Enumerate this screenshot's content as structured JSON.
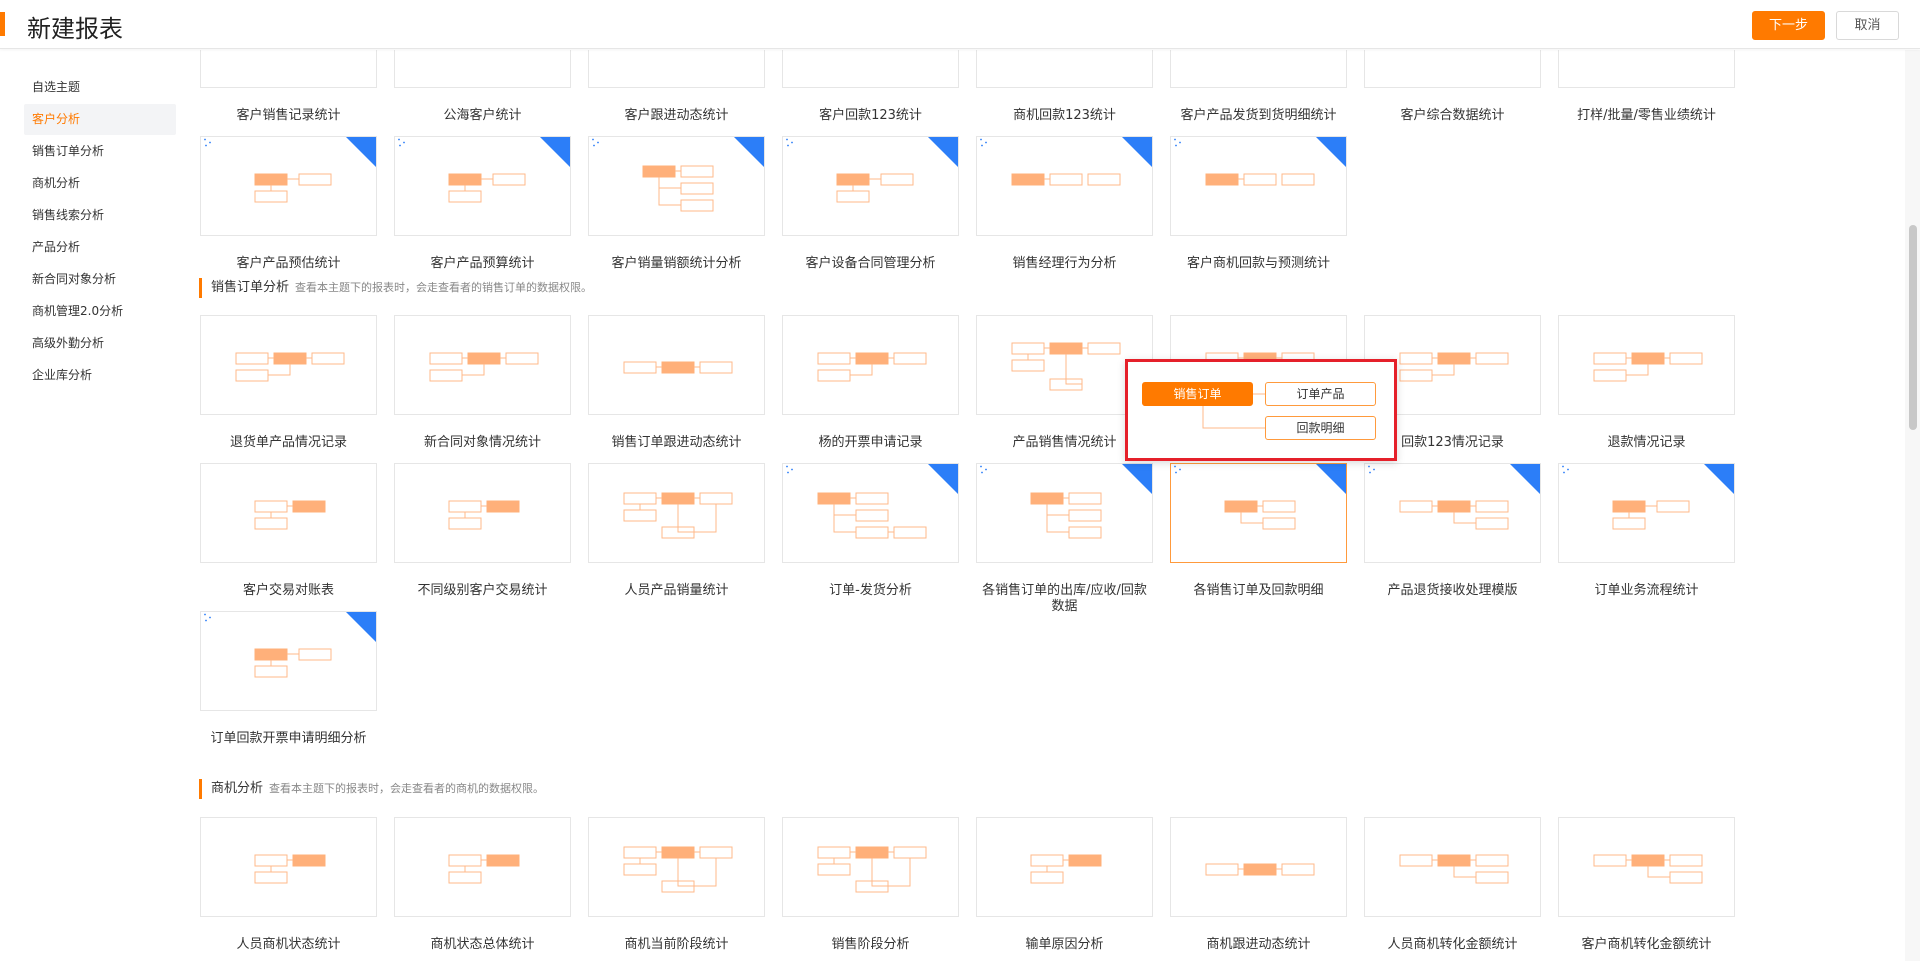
{
  "header": {
    "title": "新建报表",
    "next_label": "下一步",
    "cancel_label": "取消"
  },
  "sidebar": {
    "items": [
      {
        "label": "自选主题"
      },
      {
        "label": "客户分析"
      },
      {
        "label": "销售订单分析"
      },
      {
        "label": "商机分析"
      },
      {
        "label": "销售线索分析"
      },
      {
        "label": "产品分析"
      },
      {
        "label": "新合同对象分析"
      },
      {
        "label": "商机管理2.0分析"
      },
      {
        "label": "高级外勤分析"
      },
      {
        "label": "企业库分析"
      }
    ],
    "active_index": 1
  },
  "sections": [
    {
      "title": "销售订单分析",
      "desc": "查看本主题下的报表时，会走查看者的销售订单的数据权限。"
    },
    {
      "title": "商机分析",
      "desc": "查看本主题下的报表时，会走查看者的商机的数据权限。"
    }
  ],
  "customer_cards": [
    {
      "name": "客户销售记录统计",
      "layout": "none",
      "custom": false
    },
    {
      "name": "公海客户统计",
      "layout": "none",
      "custom": false
    },
    {
      "name": "客户跟进动态统计",
      "layout": "none",
      "custom": false
    },
    {
      "name": "客户回款123统计",
      "layout": "none",
      "custom": false
    },
    {
      "name": "商机回款123统计",
      "layout": "none",
      "custom": false
    },
    {
      "name": "客户产品发货到货明细统计",
      "layout": "none",
      "custom": false
    },
    {
      "name": "客户综合数据统计",
      "layout": "none",
      "custom": false
    },
    {
      "name": "打样/批量/零售业绩统计",
      "layout": "none",
      "custom": false
    },
    {
      "name": "客户产品预估统计",
      "layout": "L2",
      "custom": true
    },
    {
      "name": "客户产品预算统计",
      "layout": "L2",
      "custom": true
    },
    {
      "name": "客户销量销额统计分析",
      "layout": "L3",
      "custom": true
    },
    {
      "name": "客户设备合同管理分析",
      "layout": "L2",
      "custom": true
    },
    {
      "name": "销售经理行为分析",
      "layout": "L2b",
      "custom": true
    },
    {
      "name": "客户商机回款与预测统计",
      "layout": "L2b",
      "custom": true
    }
  ],
  "order_cards": [
    {
      "name": "退货单产品情况记录",
      "layout": "M3",
      "custom": false
    },
    {
      "name": "新合同对象情况统计",
      "layout": "M3",
      "custom": false
    },
    {
      "name": "销售订单跟进动态统计",
      "layout": "M3c",
      "custom": false
    },
    {
      "name": "杨的开票申请记录",
      "layout": "M3",
      "custom": false
    },
    {
      "name": "产品销售情况统计",
      "layout": "TREE",
      "custom": false
    },
    {
      "name": "",
      "layout": "M3",
      "custom": false
    },
    {
      "name": "回款123情况记录",
      "layout": "M3",
      "custom": false
    },
    {
      "name": "退款情况记录",
      "layout": "M3",
      "custom": false
    },
    {
      "name": "客户交易对账表",
      "layout": "R2",
      "custom": false
    },
    {
      "name": "不同级别客户交易统计",
      "layout": "R2",
      "custom": false
    },
    {
      "name": "人员产品销量统计",
      "layout": "W",
      "custom": false
    },
    {
      "name": "订单-发货分析",
      "layout": "L4",
      "custom": true
    },
    {
      "name": "各销售订单的出库/应收/回款数据",
      "layout": "L3",
      "custom": true
    },
    {
      "name": "各销售订单及回款明细",
      "layout": "L2s",
      "custom": true
    },
    {
      "name": "产品退货接收处理模版",
      "layout": "M3b",
      "custom": true
    },
    {
      "name": "订单业务流程统计",
      "layout": "L2",
      "custom": true
    },
    {
      "name": "订单回款开票申请明细分析",
      "layout": "L2",
      "custom": true
    }
  ],
  "opportunity_cards": [
    {
      "name": "人员商机状态统计",
      "layout": "R2",
      "custom": false
    },
    {
      "name": "商机状态总体统计",
      "layout": "R2",
      "custom": false
    },
    {
      "name": "商机当前阶段统计",
      "layout": "W",
      "custom": false
    },
    {
      "name": "销售阶段分析",
      "layout": "W",
      "custom": false
    },
    {
      "name": "输单原因分析",
      "layout": "R2",
      "custom": false
    },
    {
      "name": "商机跟进动态统计",
      "layout": "M3c",
      "custom": false
    },
    {
      "name": "人员商机转化金额统计",
      "layout": "M3b",
      "custom": false
    },
    {
      "name": "客户商机转化金额统计",
      "layout": "M3b",
      "custom": false
    }
  ],
  "popup": {
    "main": "销售订单",
    "child1": "订单产品",
    "child2": "回款明细"
  },
  "colors": {
    "accent": "#ff7a00",
    "node_fill": "#ffb07a",
    "node_line": "#ffb98a",
    "corner": "#2c7ef8",
    "highlight_border": "#e5202a"
  }
}
